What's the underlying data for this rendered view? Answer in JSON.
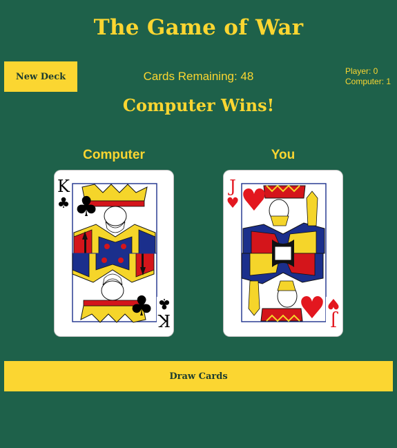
{
  "game": {
    "title": "The Game of War",
    "result": "Computer Wins!"
  },
  "controls": {
    "new_deck_label": "New Deck",
    "draw_label": "Draw Cards"
  },
  "deck": {
    "remaining_text": "Cards Remaining: 48",
    "remaining": 48
  },
  "scores": {
    "player_text": "Player: 0",
    "computer_text": "Computer: 1"
  },
  "players": {
    "computer": {
      "label": "Computer",
      "card": {
        "rank": "K",
        "suit": "clubs",
        "suit_symbol": "♣",
        "color": "#000000"
      }
    },
    "you": {
      "label": "You",
      "card": {
        "rank": "J",
        "suit": "hearts",
        "suit_symbol": "♥",
        "color": "#e3171f"
      }
    }
  },
  "colors": {
    "background": "#1e614a",
    "accent": "#fbd631",
    "button_text": "#1e3d2f"
  }
}
